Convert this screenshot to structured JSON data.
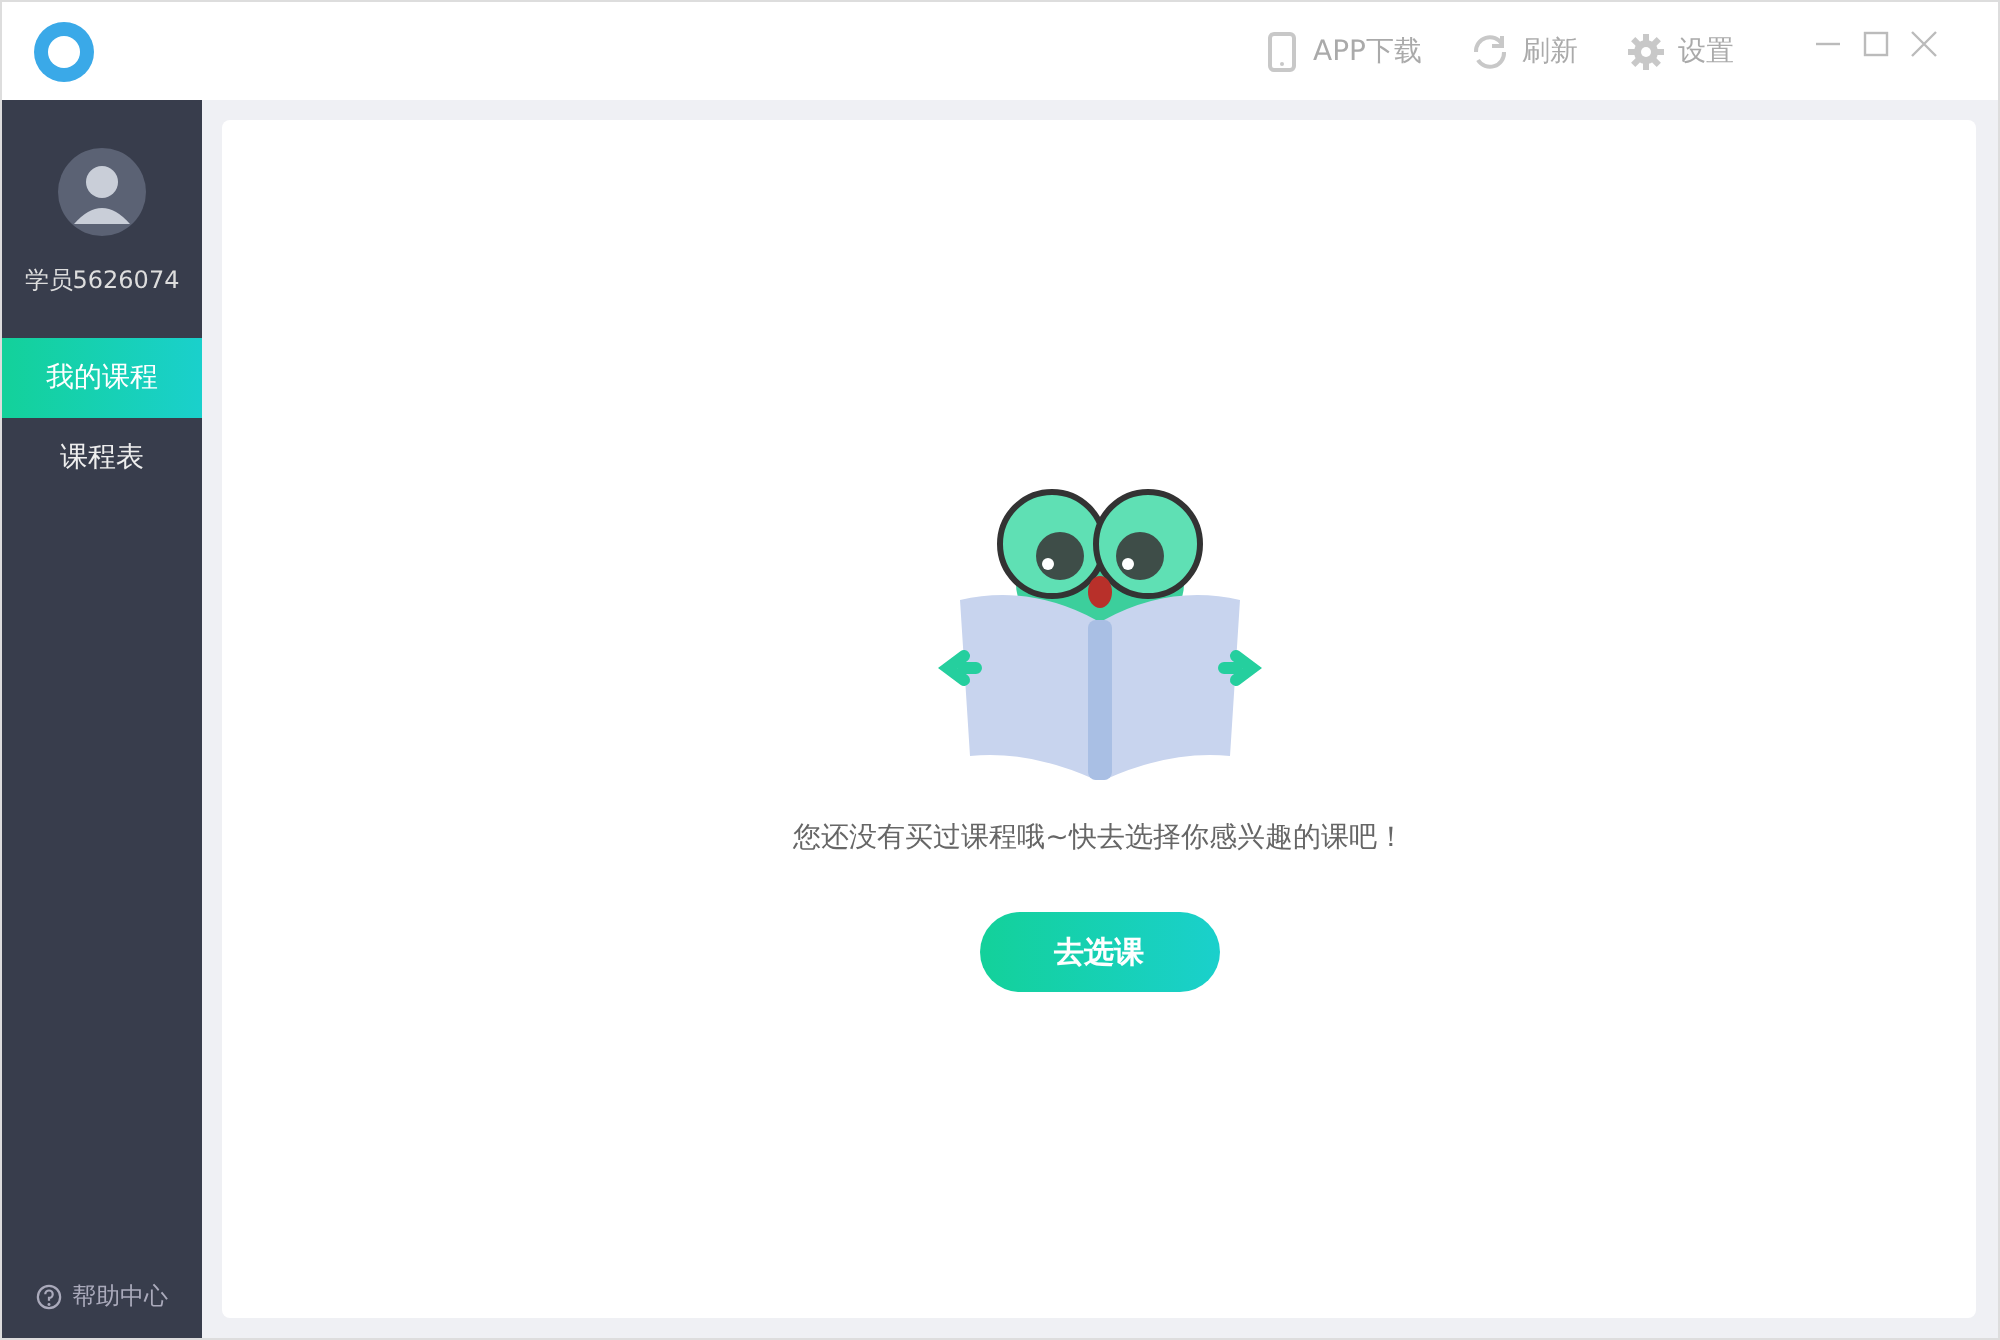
{
  "toolbar": [
    {
      "kind": "phone",
      "label": "APP下载"
    },
    {
      "kind": "refresh",
      "label": "刷新"
    },
    {
      "kind": "gear",
      "label": "设置"
    }
  ],
  "window_controls": [
    {
      "kind": "minimize"
    },
    {
      "kind": "maximize"
    },
    {
      "kind": "close"
    }
  ],
  "user": {
    "name": "学员5626074"
  },
  "sidebar": {
    "items": [
      {
        "label": "我的课程",
        "selected": true
      },
      {
        "label": "课程表",
        "selected": false
      }
    ],
    "footer": "帮助中心"
  },
  "empty_state": {
    "message": "您还没有买过课程哦~快去选择你感兴趣的课吧！",
    "button": "去选课"
  }
}
